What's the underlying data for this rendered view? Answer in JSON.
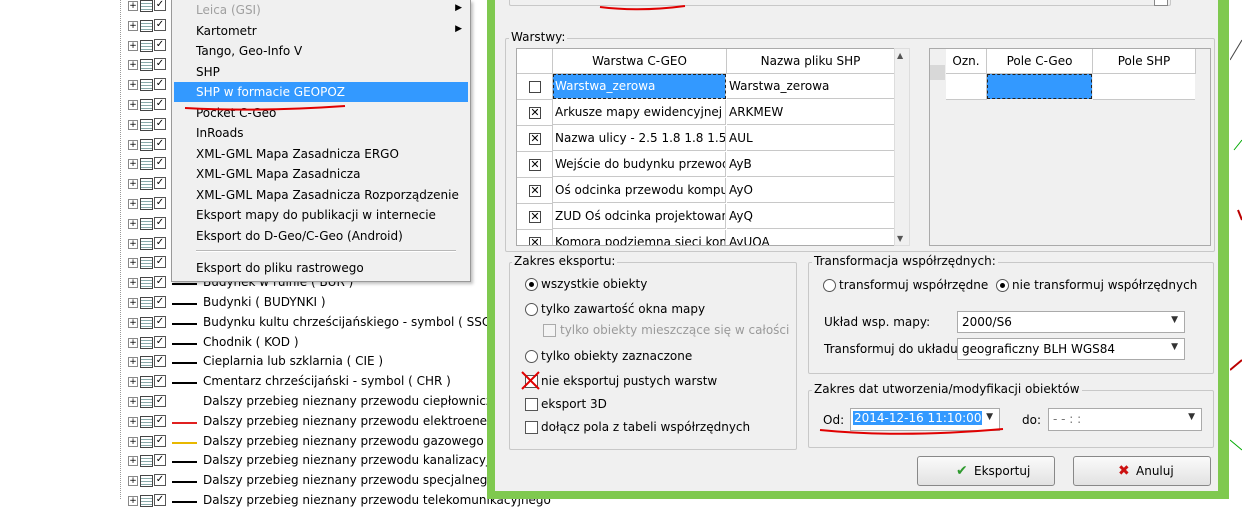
{
  "tree": {
    "rows": [
      {
        "label": "",
        "sym": "none"
      },
      {
        "label": "",
        "sym": "none"
      },
      {
        "label": "",
        "sym": "none"
      },
      {
        "label": "",
        "sym": "none"
      },
      {
        "label": "",
        "sym": "none"
      },
      {
        "label": "",
        "sym": "none"
      },
      {
        "label": "",
        "sym": "none"
      },
      {
        "label": "",
        "sym": "none"
      },
      {
        "label": "",
        "sym": "none"
      },
      {
        "label": "",
        "sym": "none"
      },
      {
        "label": "",
        "sym": "none"
      },
      {
        "label": "",
        "sym": "none"
      },
      {
        "label": "",
        "sym": "none"
      },
      {
        "label": "",
        "sym": "none"
      },
      {
        "label": "Budynek w ruinie ( BUR )",
        "sym": "black"
      },
      {
        "label": "Budynki ( BUDYNKI )",
        "sym": "black"
      },
      {
        "label": "Budynku kultu chrześcijańskiego - symbol ( SSCB )",
        "sym": "black"
      },
      {
        "label": "Chodnik ( KOD )",
        "sym": "black"
      },
      {
        "label": "Cieplarnia lub szklarnia ( CIE )",
        "sym": "black"
      },
      {
        "label": "Cmentarz chrześcijański - symbol ( CHR )",
        "sym": "black"
      },
      {
        "label": "Dalszy przebieg nieznany przewodu ciepłowniczego",
        "sym": "none"
      },
      {
        "label": "Dalszy przebieg nieznany przewodu elektroenergetycznego",
        "sym": "red"
      },
      {
        "label": "Dalszy przebieg nieznany przewodu gazowego ( Gy",
        "sym": "yellow"
      },
      {
        "label": "Dalszy przebieg nieznany przewodu kanalizacyjnego",
        "sym": "black"
      },
      {
        "label": "Dalszy przebieg nieznany przewodu specjalnego ( X",
        "sym": "black"
      },
      {
        "label": "Dalszy przebieg nieznany przewodu telekomunikacyjnego",
        "sym": "black"
      }
    ]
  },
  "menu": {
    "items": [
      {
        "label": "Leica (GSI)",
        "state": "disabled",
        "submenu": true
      },
      {
        "label": "Kartometr",
        "state": "normal",
        "submenu": true
      },
      {
        "label": "Tango, Geo-Info V",
        "state": "normal",
        "submenu": false
      },
      {
        "label": "SHP",
        "state": "normal",
        "submenu": false
      },
      {
        "label": "SHP w formacie GEOPOZ",
        "state": "selected",
        "submenu": false
      },
      {
        "label": "Pocket C-Geo",
        "state": "normal",
        "submenu": false
      },
      {
        "label": "InRoads",
        "state": "normal",
        "submenu": false
      },
      {
        "label": "XML-GML Mapa Zasadnicza ERGO",
        "state": "normal",
        "submenu": false
      },
      {
        "label": "XML-GML Mapa Zasadnicza",
        "state": "normal",
        "submenu": false
      },
      {
        "label": "XML-GML Mapa Zasadnicza Rozporządzenie",
        "state": "normal",
        "submenu": false
      },
      {
        "label": "Eksport mapy do publikacji w internecie",
        "state": "normal",
        "submenu": false
      },
      {
        "label": "Eksport do D-Geo/C-Geo (Android)",
        "state": "normal",
        "submenu": false
      },
      {
        "label": "Eksport do pliku rastrowego",
        "state": "normal",
        "submenu": false
      }
    ],
    "submenu_arrow": "▶"
  },
  "dialog": {
    "layers_group_title": "Warstwy:",
    "layers_table": {
      "headers": [
        "",
        "Warstwa C-GEO",
        "Nazwa pliku SHP"
      ],
      "rows": [
        {
          "checked": false,
          "layer": "Warstwa_zerowa",
          "file": "Warstwa_zerowa"
        },
        {
          "checked": true,
          "layer": "Arkusze mapy ewidencyjnej",
          "file": "ARKMEW"
        },
        {
          "checked": true,
          "layer": "Nazwa ulicy - 2.5 1.8 1.8 1.5",
          "file": "AUL"
        },
        {
          "checked": true,
          "layer": "Wejście do budynku przewodu",
          "file": "AyB"
        },
        {
          "checked": true,
          "layer": "Oś odcinka przewodu komput",
          "file": "AyO"
        },
        {
          "checked": true,
          "layer": "ZUD Oś odcinka projektowanego",
          "file": "AyQ"
        },
        {
          "checked": true,
          "layer": "Komora podziemna sieci kom",
          "file": "AyUOA"
        }
      ]
    },
    "fields_table": {
      "headers": [
        "Ozn.",
        "Pole C-Geo",
        "Pole SHP"
      ]
    },
    "export_scope": {
      "title": "Zakres eksportu:",
      "all_objects": "wszystkie obiekty",
      "window_only": "tylko zawartość okna mapy",
      "fit_whole": "tylko obiekty mieszczące się w całości",
      "selected_only": "tylko obiekty zaznaczone",
      "no_empty": "nie eksportuj pustych warstw",
      "export_3d": "eksport 3D",
      "attach_coords": "dołącz pola z tabeli współrzędnych"
    },
    "transform": {
      "title": "Transformacja współrzędnych:",
      "do_transform": "transformuj współrzędne",
      "no_transform": "nie transformuj współrzędnych",
      "map_system_label": "Układ wsp. mapy:",
      "map_system_value": "2000/S6",
      "target_label": "Transformuj do układu:",
      "target_value": "geograficzny BLH WGS84"
    },
    "dates": {
      "title": "Zakres dat utworzenia/modyfikacji obiektów",
      "from_label": "Od:",
      "from_value": "2014-12-16 11:10:00",
      "to_label": "do:",
      "to_value": "- -   : :"
    },
    "buttons": {
      "export": "Eksportuj",
      "cancel": "Anuluj"
    },
    "icons": {
      "export": "checkmark-icon",
      "cancel": "x-icon"
    },
    "scroll_up": "▲",
    "scroll_down": "▼",
    "dropdown_arrow": "▼"
  },
  "colors": {
    "dialog_frame": "#7fc94f",
    "selection": "#3399ff",
    "annotation": "#e00000"
  }
}
